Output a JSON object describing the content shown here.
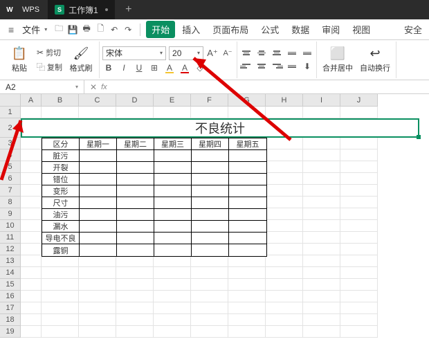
{
  "titlebar": {
    "app": "WPS",
    "tab_label": "工作簿1",
    "tab_icon": "S"
  },
  "menubar": {
    "file": "文件",
    "items": [
      "开始",
      "插入",
      "页面布局",
      "公式",
      "数据",
      "审阅",
      "视图",
      "安全"
    ]
  },
  "ribbon": {
    "paste": "粘贴",
    "cut": "剪切",
    "copy": "复制",
    "format_painter": "格式刷",
    "font_name": "宋体",
    "font_size": "20",
    "merge_center": "合并居中",
    "auto_wrap": "自动换行"
  },
  "namebox": {
    "ref": "A2"
  },
  "sheet": {
    "columns": [
      "A",
      "B",
      "C",
      "D",
      "E",
      "F",
      "G",
      "H",
      "I",
      "J"
    ],
    "rows": 19,
    "title": "不良统计",
    "table": {
      "header": [
        "区分",
        "星期一",
        "星期二",
        "星期三",
        "星期四",
        "星期五"
      ],
      "rows": [
        "脏污",
        "开裂",
        "错位",
        "变形",
        "尺寸",
        "油污",
        "漏水",
        "导电不良",
        "露铜"
      ]
    }
  }
}
